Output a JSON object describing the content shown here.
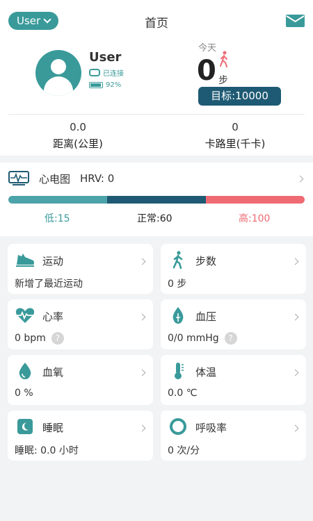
{
  "header": {
    "user_label": "User",
    "title": "首页",
    "mail_icon": "mail-icon"
  },
  "profile": {
    "name": "User",
    "status": "已连接",
    "battery": "92%",
    "battery_level": 0.92
  },
  "today": {
    "label": "今天",
    "steps": "0",
    "unit": "步",
    "goal": "目标:10000"
  },
  "stats": {
    "distance_value": "0.0",
    "distance_label": "距离(公里)",
    "calorie_value": "0",
    "calorie_label": "卡路里(千卡)"
  },
  "ecg": {
    "title": "心电图",
    "hrv": "HRV: 0",
    "low": "低:15",
    "normal": "正常:60",
    "high": "高:100"
  },
  "cards": [
    {
      "title": "运动",
      "value": "新增了最近运动",
      "icon": "shoe-icon"
    },
    {
      "title": "步数",
      "value": "0 步",
      "icon": "walk-icon"
    },
    {
      "title": "心率",
      "value": "0 bpm",
      "icon": "heart-rate-icon",
      "help": "?"
    },
    {
      "title": "血压",
      "value": "0/0 mmHg",
      "icon": "blood-drop-icon",
      "help": "?"
    },
    {
      "title": "血氧",
      "value": "0 %",
      "icon": "oxygen-drop-icon"
    },
    {
      "title": "体温",
      "value": "0.0 ℃",
      "icon": "thermometer-icon"
    },
    {
      "title": "睡眠",
      "value": "睡眠: 0.0 小时",
      "icon": "sleep-icon"
    },
    {
      "title": "呼吸率",
      "value": "0 次/分",
      "icon": "breath-ring-icon"
    }
  ],
  "colors": {
    "teal": "#3a9a9a",
    "navy": "#1e5a73",
    "red": "#ef6a72"
  }
}
